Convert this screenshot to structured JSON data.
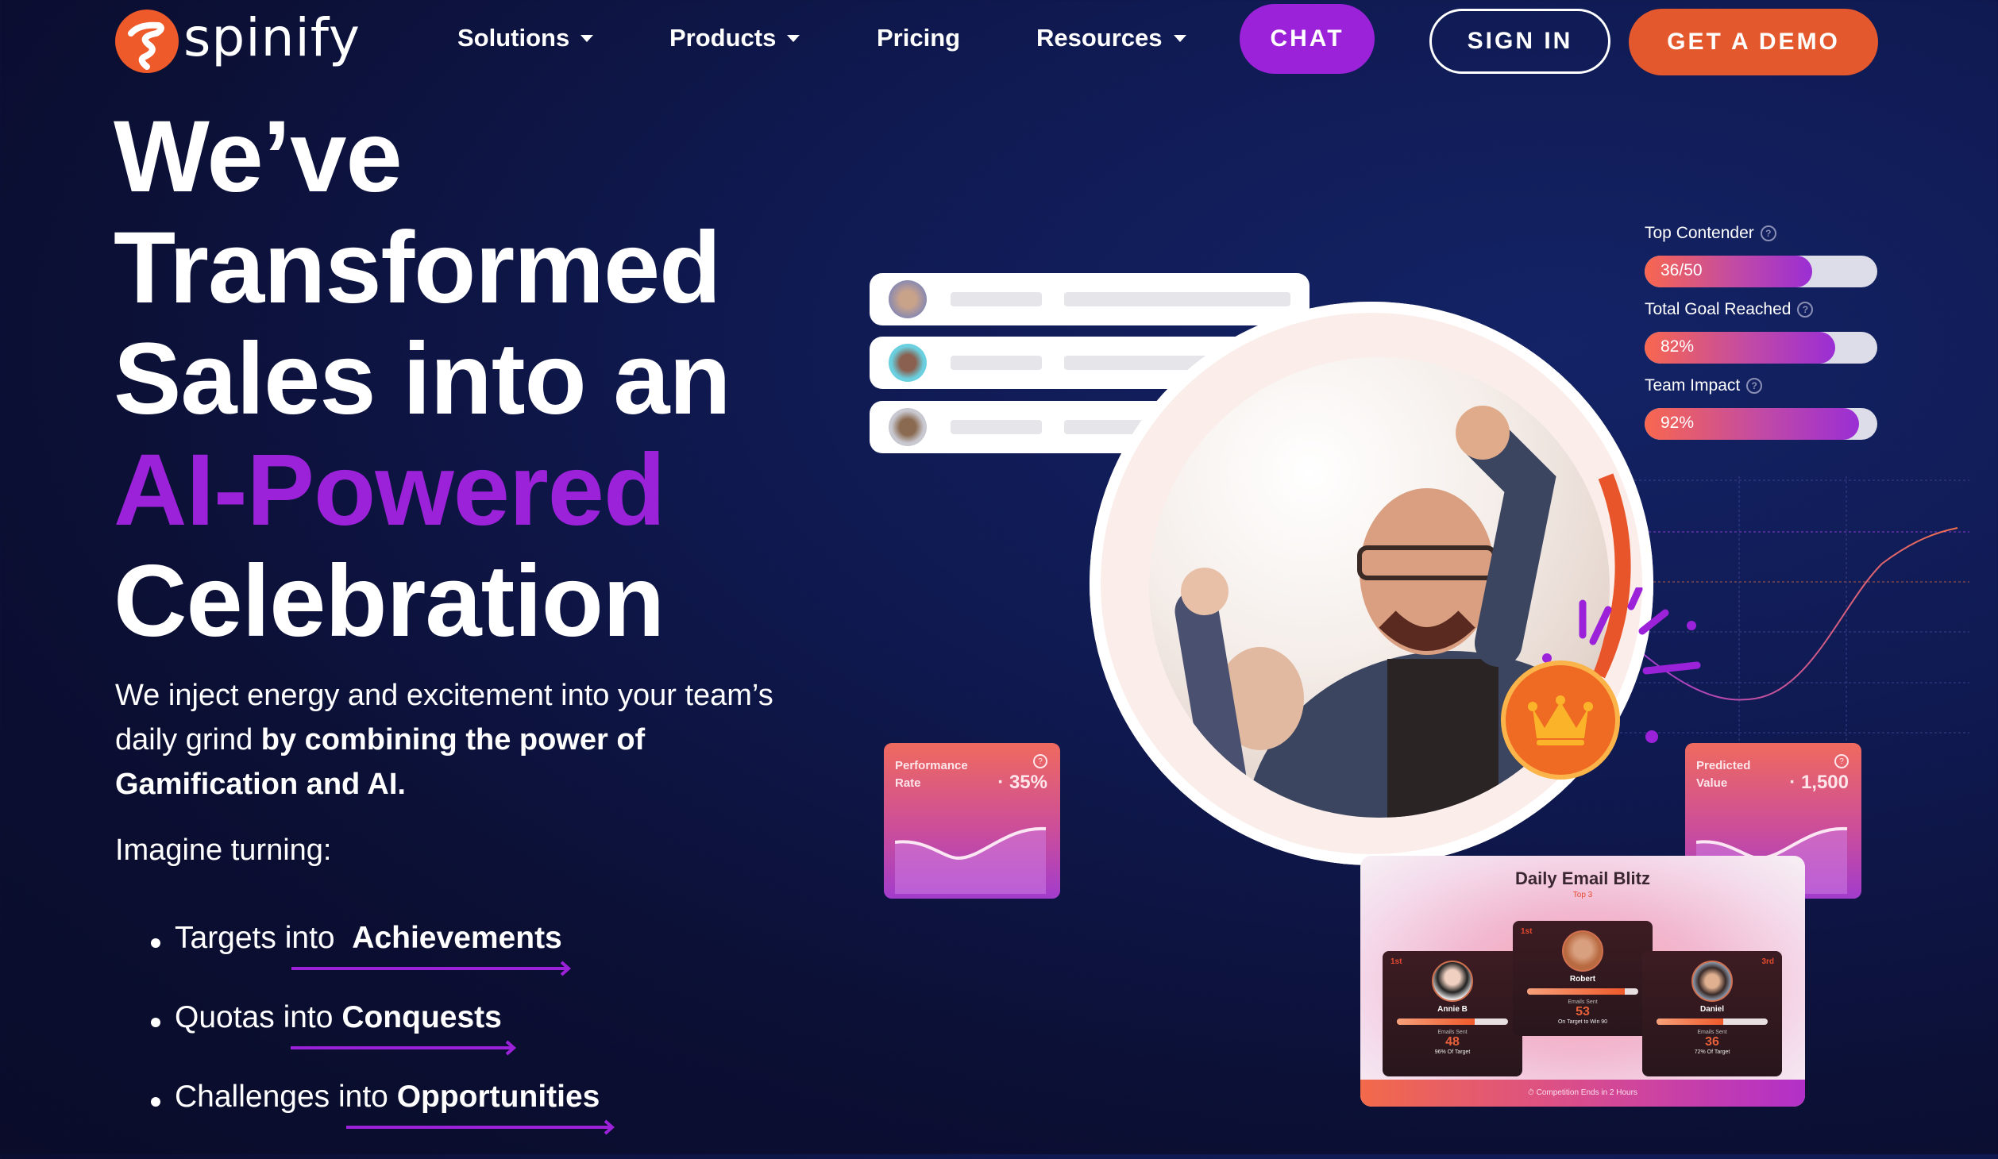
{
  "brand": {
    "name": "spinify",
    "logo_icon": "spinify-swirl-logo",
    "accent_orange": "#e4582d",
    "accent_purple": "#9b22d9"
  },
  "nav": {
    "items": [
      {
        "label": "Solutions",
        "has_dropdown": true
      },
      {
        "label": "Products",
        "has_dropdown": true
      },
      {
        "label": "Pricing",
        "has_dropdown": false
      },
      {
        "label": "Resources",
        "has_dropdown": true
      }
    ],
    "chat_label": "CHAT",
    "signin_label": "SIGN IN",
    "demo_label": "GET A DEMO"
  },
  "hero": {
    "headline_lines": [
      "We’ve",
      "Transformed",
      "Sales into an"
    ],
    "headline_highlight": "AI-Powered",
    "headline_last": "Celebration",
    "paragraph_plain": "We inject energy and excitement into your team’s daily grind ",
    "paragraph_bold": "by combining the power of Gamification and AI.",
    "imagine": "Imagine turning:",
    "bullets": [
      {
        "plain": "Targets into ",
        "bold": "Achievements"
      },
      {
        "plain": "Quotas into ",
        "bold": "Conquests"
      },
      {
        "plain": "Challenges into ",
        "bold": "Opportunities"
      }
    ]
  },
  "visual": {
    "metrics": [
      {
        "label": "Top Contender",
        "value_text": "36/50",
        "fill_fraction": 0.72
      },
      {
        "label": "Total Goal Reached",
        "value_text": "82%",
        "fill_fraction": 0.82
      },
      {
        "label": "Team Impact",
        "value_text": "92%",
        "fill_fraction": 0.92
      }
    ],
    "performance_card": {
      "title_line1": "Performance",
      "title_line2": "Rate",
      "value": "35%"
    },
    "predicted_card": {
      "title_line1": "Predicted",
      "title_line2": "Value",
      "value": "1,500"
    },
    "blitz": {
      "title": "Daily Email Blitz",
      "subtitle": "Top 3",
      "podium": [
        {
          "rank": "1st",
          "name": "Annie B",
          "score": "48",
          "label": "Emails Sent",
          "sub": "96% Of Target",
          "fill": 0.7
        },
        {
          "rank": "1st",
          "name": "Robert",
          "score": "53",
          "label": "Emails Sent",
          "sub": "On Target to Win 90",
          "fill": 0.88
        },
        {
          "rank": "3rd",
          "name": "Daniel",
          "score": "36",
          "label": "Emails Sent",
          "sub": "72% Of Target",
          "fill": 0.6
        }
      ],
      "footer": "Competition Ends in 2 Hours"
    }
  }
}
